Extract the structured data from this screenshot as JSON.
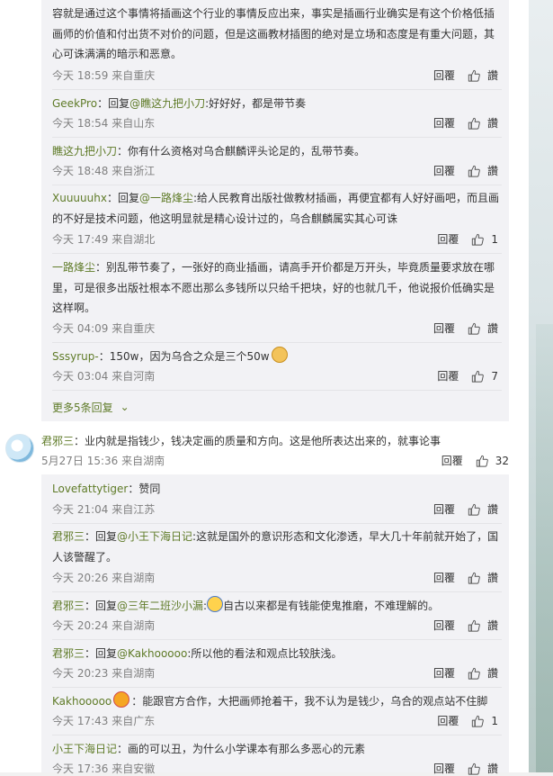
{
  "top_comment_tail": {
    "line1": "容就是通过这个事情将插画这个行业的事情反应出来，事实是插画行业确实是有这个价格低插",
    "line2": "画师的价值和付出货不对价的问题，但是这画教材插图的绝对是立场和态度是有重大问题，其",
    "line3": "心可诛满满的暗示和恶意。",
    "meta": "今天 18:59 来自重庆",
    "likes": ""
  },
  "reply_label": "回覆",
  "replies_a": [
    {
      "user": "GeekPro",
      "prefix": "：回复",
      "mention": "@瞧这九把小刀",
      "text": ":好好好，都是带节奏",
      "meta": "今天 18:54 来自山东",
      "likes": ""
    },
    {
      "user": "瞧这九把小刀",
      "prefix": "：你有什么资格对乌合麒麟评头论足的，乱带节奏。",
      "mention": "",
      "text": "",
      "meta": "今天 18:48 来自浙江",
      "likes": ""
    },
    {
      "user": "Xuuuuuhx",
      "prefix": "：回复",
      "mention": "@一路烽尘",
      "text": ":给人民教育出版社做教材插画，再便宜都有人好好画吧，而且画",
      "text2": "的不好是技术问题，他这明显就是精心设计过的，乌合麒麟属实其心可诛",
      "meta": "今天 17:49 来自湖北",
      "likes": "1"
    },
    {
      "user": "一路烽尘",
      "prefix": "：别乱带节奏了，一张好的商业插画，请高手开价都是万开头，毕竟质量要求放在哪",
      "line2": "里，可是很多出版社根本不愿出那么多钱所以只给千把块，好的也就几千，他说报价低确实是",
      "line3": "这样啊。",
      "meta": "今天 04:09 来自重庆",
      "likes": ""
    },
    {
      "user": "Sssyrup-",
      "prefix": "：150w，因为乌合之众是三个50w",
      "meta": "今天 03:04 来自河南",
      "likes": "7"
    }
  ],
  "more_replies": "更多5条回复",
  "main_comment": {
    "user": "君邪三",
    "text": "：业内就是指钱少，钱决定画的质量和方向。这是他所表达出来的，就事论事",
    "meta": "5月27日 15:36 来自湖南",
    "likes": "32"
  },
  "replies_b": [
    {
      "user": "Lovefattytiger",
      "text": "：赞同",
      "meta": "今天 21:04 来自江苏",
      "likes": ""
    },
    {
      "user": "君邪三",
      "prefix": "：回复",
      "mention": "@小王下海日记",
      "text": ":这就是国外的意识形态和文化渗透，早大几十年前就开始了，国",
      "line2": "人该警醒了。",
      "meta": "今天 20:26 来自湖南",
      "likes": ""
    },
    {
      "user": "君邪三",
      "prefix": "：回复",
      "mention": "@三年二班沙小漏",
      "text": ":",
      "after": "自古以来都是有钱能使鬼推磨，不难理解的。",
      "meta": "今天 20:24 来自湖南",
      "likes": ""
    },
    {
      "user": "君邪三",
      "prefix": "：回复",
      "mention": "@Kakhooooo",
      "text": ":所以他的看法和观点比较肤浅。",
      "meta": "今天 20:23 来自湖南",
      "likes": ""
    },
    {
      "user": "Kakhooooo",
      "text": "：能跟官方合作，大把画师抢着干，我不认为是钱少，乌合的观点站不住脚",
      "meta": "今天 17:43 来自广东",
      "likes": "1"
    },
    {
      "user": "小王下海日记",
      "text": "：画的可以丑，为什么小学课本有那么多恶心的元素",
      "meta": "今天 17:36 来自安徽",
      "likes": ""
    }
  ],
  "icons": {
    "like": "thumbs-up-icon",
    "chevron": "chevron-down-icon"
  }
}
